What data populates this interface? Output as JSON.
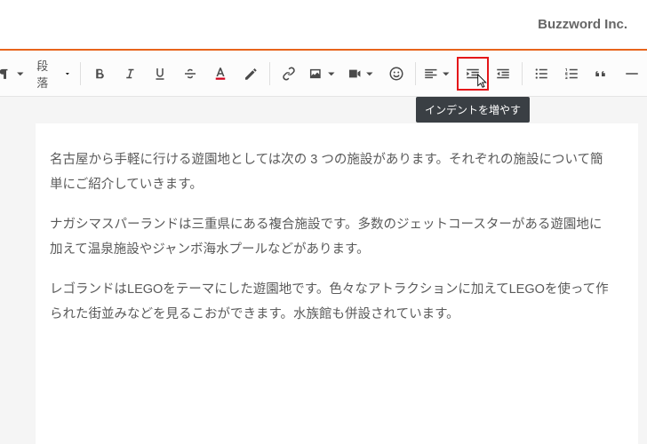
{
  "header": {
    "brand": "Buzzword Inc."
  },
  "toolbar": {
    "paragraph_label": "段落",
    "tooltip": "インデントを増やす"
  },
  "content": {
    "p1": "名古屋から手軽に行ける遊園地としては次の 3 つの施設があります。それぞれの施設について簡単にご紹介していきます。",
    "p2": "ナガシマスパーランドは三重県にある複合施設です。多数のジェットコースターがある遊園地に加えて温泉施設やジャンボ海水プールなどがあります。",
    "p3": "レゴランドはLEGOをテーマにした遊園地です。色々なアトラクションに加えてLEGOを使って作られた街並みなどを見るこおができます。水族館も併設されています。"
  }
}
